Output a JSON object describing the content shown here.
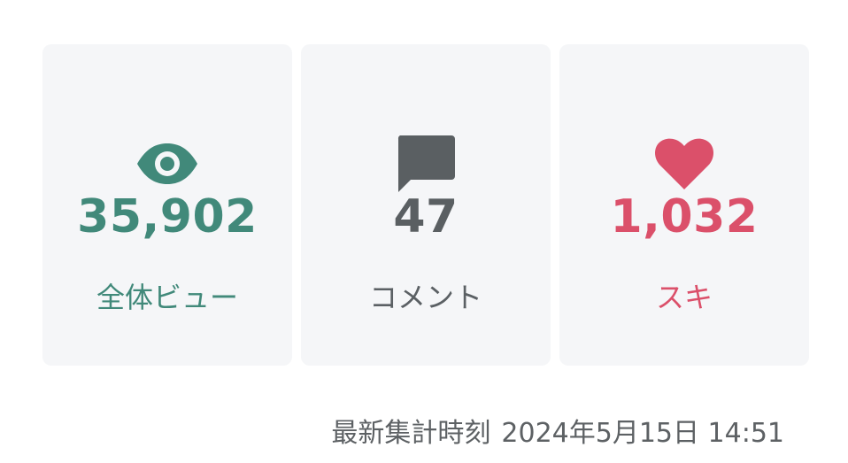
{
  "stats": {
    "views": {
      "value": "35,902",
      "label": "全体ビュー",
      "icon": "eye-icon",
      "color": "#41897a"
    },
    "comments": {
      "value": "47",
      "label": "コメント",
      "icon": "comment-icon",
      "color": "#5a5f62"
    },
    "likes": {
      "value": "1,032",
      "label": "スキ",
      "icon": "heart-icon",
      "color": "#db506a"
    }
  },
  "footer": {
    "updated_label": "最新集計時刻",
    "updated_time": "2024年5月15日 14:51"
  }
}
